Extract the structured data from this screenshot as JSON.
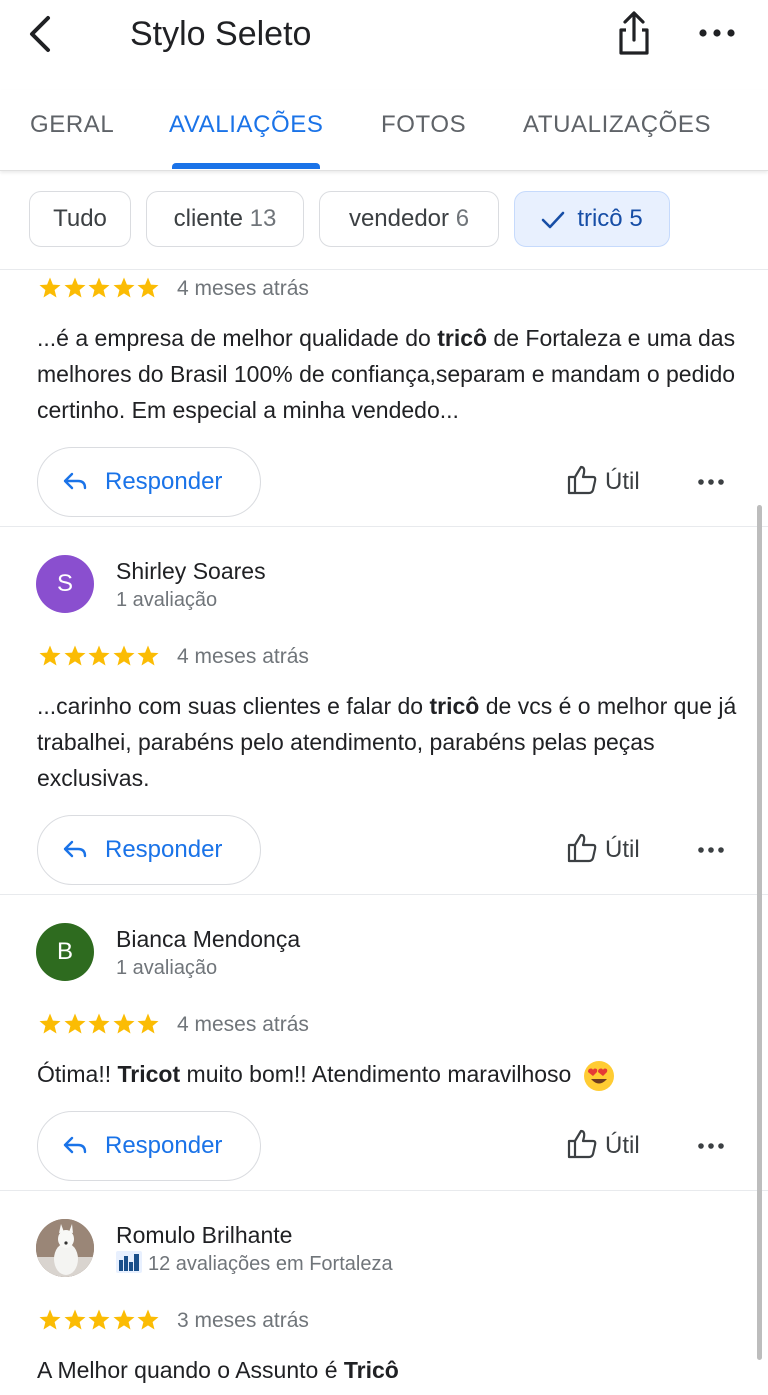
{
  "header": {
    "title": "Stylo Seleto",
    "back_icon": "back-arrow-icon",
    "share_icon": "share-icon",
    "more_icon": "more-horizontal-icon"
  },
  "tabs": [
    {
      "label": "GERAL",
      "active": false
    },
    {
      "label": "AVALIAÇÕES",
      "active": true
    },
    {
      "label": "FOTOS",
      "active": false
    },
    {
      "label": "ATUALIZAÇÕES",
      "active": false
    }
  ],
  "filters": [
    {
      "label": "Tudo",
      "count": ""
    },
    {
      "label": "cliente",
      "count": "13"
    },
    {
      "label": "vendedor",
      "count": "6"
    },
    {
      "label": "tricô",
      "count": "5",
      "selected": true
    }
  ],
  "colors": {
    "accent": "#1a73e8",
    "star": "#fbbc04",
    "avatar_shirley": "#8a4fcf",
    "avatar_bianca": "#2e6b1f"
  },
  "reviews": [
    {
      "rating": 5,
      "time": "4 meses atrás",
      "text_pre": "...é a empresa de melhor qualidade do ",
      "text_bold": "tricô",
      "text_post": " de Fortaleza e uma das melhores do Brasil 100% de confiança,separam e mandam o pedido certinho. Em especial a minha vendedo...",
      "reply": "Responder",
      "useful": "Útil"
    },
    {
      "name": "Shirley Soares",
      "initial": "S",
      "meta": "1 avaliação",
      "rating": 5,
      "time": "4 meses atrás",
      "text_pre": "...carinho com suas clientes e falar do ",
      "text_bold": "tricô",
      "text_post": " de vcs é o melhor que já trabalhei, parabéns pelo atendimento, parabéns pelas peças exclusivas.",
      "reply": "Responder",
      "useful": "Útil"
    },
    {
      "name": "Bianca Mendonça",
      "initial": "B",
      "meta": "1 avaliação",
      "rating": 5,
      "time": "4 meses atrás",
      "text_pre": "Ótima!! ",
      "text_bold": "Tricot",
      "text_post": " muito bom!! Atendimento maravilhoso",
      "emoji": "heart-eyes-emoji-icon",
      "reply": "Responder",
      "useful": "Útil"
    },
    {
      "name": "Romulo Brilhante",
      "meta": "12 avaliações em Fortaleza",
      "badge_icon": "local-guide-badge-icon",
      "rating": 5,
      "time": "3 meses atrás",
      "text_pre": "A Melhor quando o Assunto é ",
      "text_bold": "Tricô",
      "text_post": ""
    }
  ]
}
